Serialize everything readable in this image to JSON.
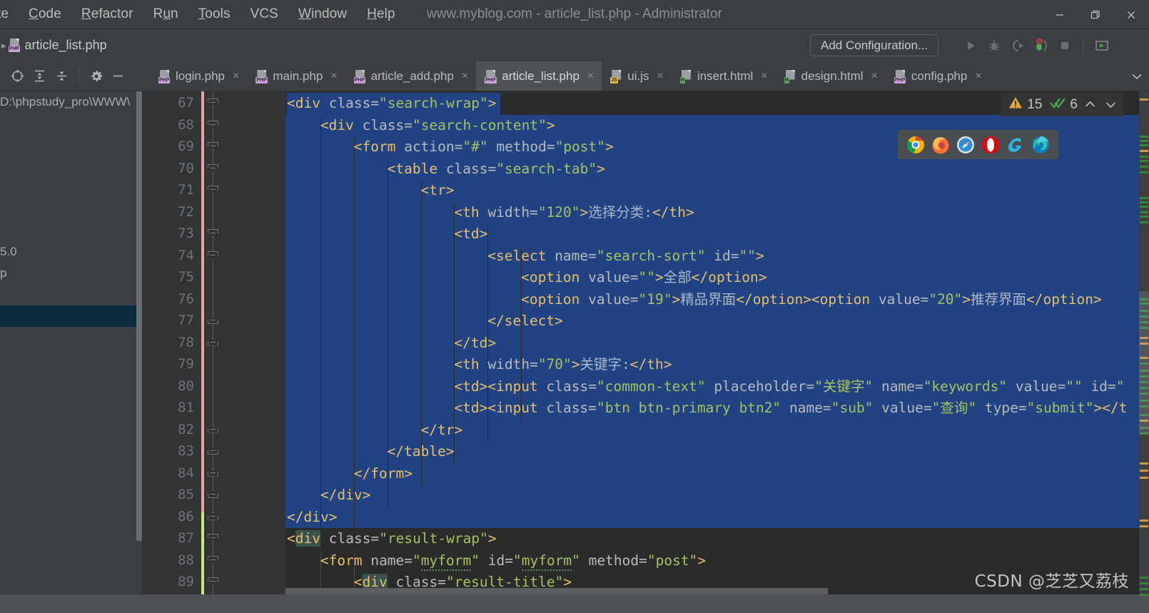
{
  "window": {
    "title": "www.myblog.com - article_list.php - Administrator",
    "controls": {
      "minimize": "minimize-icon",
      "restore": "restore-icon",
      "close": "close-icon"
    }
  },
  "menubar": {
    "items": [
      {
        "label": "te",
        "mnemonic": ""
      },
      {
        "label": "Code",
        "mnemonic": "C"
      },
      {
        "label": "Refactor",
        "mnemonic": "R"
      },
      {
        "label": "Run",
        "mnemonic": "u"
      },
      {
        "label": "Tools",
        "mnemonic": "T"
      },
      {
        "label": "VCS",
        "mnemonic": ""
      },
      {
        "label": "Window",
        "mnemonic": "W"
      },
      {
        "label": "Help",
        "mnemonic": "H"
      }
    ]
  },
  "navbar": {
    "breadcrumb": "article_list.php",
    "add_configuration": "Add Configuration...",
    "run_icons": [
      "run-icon",
      "debug-icon",
      "run-with-coverage-icon",
      "profile-icon",
      "stop-icon",
      "run-tool-icon"
    ]
  },
  "left_toolbar": {
    "buttons": [
      "locate-icon",
      "expand-all-icon",
      "collapse-all-icon",
      "settings-gear-icon",
      "hide-icon"
    ]
  },
  "tabs": {
    "items": [
      {
        "label": "login.php",
        "type": "PHP",
        "active": false
      },
      {
        "label": "main.php",
        "type": "PHP",
        "active": false
      },
      {
        "label": "article_add.php",
        "type": "PHP",
        "active": false
      },
      {
        "label": "article_list.php",
        "type": "PHP",
        "active": true
      },
      {
        "label": "ui.js",
        "type": "JS",
        "active": false
      },
      {
        "label": "insert.html",
        "type": "H",
        "active": false
      },
      {
        "label": "design.html",
        "type": "H",
        "active": false
      },
      {
        "label": "config.php",
        "type": "PHP",
        "active": false
      }
    ],
    "close_glyph": "×",
    "overflow_glyph": "⌄"
  },
  "project_panel": {
    "rows": [
      {
        "text": "D:\\phpstudy_pro\\WWW\\",
        "selected": false,
        "color": "#aaadaf"
      },
      {
        "text": "",
        "selected": false,
        "color": "#aaadaf"
      },
      {
        "text": "",
        "selected": false,
        "color": "#aaadaf"
      },
      {
        "text": "",
        "selected": false,
        "color": "#aaadaf"
      },
      {
        "text": "",
        "selected": false,
        "color": "#aaadaf"
      },
      {
        "text": "",
        "selected": false,
        "color": "#aaadaf"
      },
      {
        "text": "",
        "selected": false,
        "color": "#aaadaf"
      },
      {
        "text": "5.0",
        "selected": false,
        "color": "#aaadaf"
      },
      {
        "text": "p",
        "selected": false,
        "color": "#aaadaf"
      },
      {
        "text": "",
        "selected": false,
        "color": "#cc8242"
      },
      {
        "text": "",
        "selected": true,
        "color": "#aaadaf"
      }
    ]
  },
  "inspections": {
    "warning_icon": "warning-triangle-icon",
    "warning_count": "15",
    "check_icon": "inspection-check-icon",
    "check_count": "6",
    "prev_glyph": "⌃",
    "next_glyph": "⌄"
  },
  "browser_popup": {
    "browsers": [
      "chrome-icon",
      "firefox-icon",
      "safari-icon",
      "opera-icon",
      "internet-explorer-icon",
      "edge-icon"
    ]
  },
  "watermark": "CSDN @芝芝又荔枝",
  "editor": {
    "first_line": 67,
    "line_count": 23,
    "lines": [
      {
        "n": 67,
        "indent": 0,
        "selected": true,
        "sel_full": false,
        "tokens": [
          {
            "t": "punct",
            "s": "<div "
          },
          {
            "t": "attr",
            "s": "class="
          },
          {
            "t": "val",
            "s": "\"search-wrap\""
          },
          {
            "t": "punct",
            "s": ">"
          }
        ]
      },
      {
        "n": 68,
        "indent": 4,
        "selected": true,
        "sel_full": true,
        "tokens": [
          {
            "t": "punct",
            "s": "<div "
          },
          {
            "t": "attr",
            "s": "class="
          },
          {
            "t": "val",
            "s": "\"search-content\""
          },
          {
            "t": "punct",
            "s": ">"
          }
        ]
      },
      {
        "n": 69,
        "indent": 8,
        "selected": true,
        "sel_full": true,
        "tokens": [
          {
            "t": "punct",
            "s": "<form "
          },
          {
            "t": "attr",
            "s": "action="
          },
          {
            "t": "val",
            "s": "\"#\""
          },
          {
            "t": "text",
            "s": " "
          },
          {
            "t": "attr",
            "s": "method="
          },
          {
            "t": "val",
            "s": "\"post\""
          },
          {
            "t": "punct",
            "s": ">"
          }
        ]
      },
      {
        "n": 70,
        "indent": 12,
        "selected": true,
        "sel_full": true,
        "tokens": [
          {
            "t": "punct",
            "s": "<table "
          },
          {
            "t": "attr",
            "s": "class="
          },
          {
            "t": "val",
            "s": "\"search-tab\""
          },
          {
            "t": "punct",
            "s": ">"
          }
        ]
      },
      {
        "n": 71,
        "indent": 16,
        "selected": true,
        "sel_full": true,
        "tokens": [
          {
            "t": "punct",
            "s": "<tr>"
          }
        ]
      },
      {
        "n": 72,
        "indent": 20,
        "selected": true,
        "sel_full": true,
        "tokens": [
          {
            "t": "punct",
            "s": "<th "
          },
          {
            "t": "attr",
            "s": "width="
          },
          {
            "t": "val",
            "s": "\"120\""
          },
          {
            "t": "punct",
            "s": ">"
          },
          {
            "t": "text",
            "s": "选择分类:"
          },
          {
            "t": "punct",
            "s": "</th>"
          }
        ]
      },
      {
        "n": 73,
        "indent": 20,
        "selected": true,
        "sel_full": true,
        "tokens": [
          {
            "t": "punct",
            "s": "<td>"
          }
        ]
      },
      {
        "n": 74,
        "indent": 24,
        "selected": true,
        "sel_full": true,
        "tokens": [
          {
            "t": "punct",
            "s": "<select "
          },
          {
            "t": "attr",
            "s": "name="
          },
          {
            "t": "val",
            "s": "\"search-sort\""
          },
          {
            "t": "text",
            "s": " "
          },
          {
            "t": "attr",
            "s": "id="
          },
          {
            "t": "val",
            "s": "\"\""
          },
          {
            "t": "punct",
            "s": ">"
          }
        ]
      },
      {
        "n": 75,
        "indent": 28,
        "selected": true,
        "sel_full": true,
        "tokens": [
          {
            "t": "punct",
            "s": "<option "
          },
          {
            "t": "attr",
            "s": "value="
          },
          {
            "t": "val",
            "s": "\"\""
          },
          {
            "t": "punct",
            "s": ">"
          },
          {
            "t": "text",
            "s": "全部"
          },
          {
            "t": "punct",
            "s": "</option>"
          }
        ]
      },
      {
        "n": 76,
        "indent": 28,
        "selected": true,
        "sel_full": true,
        "tokens": [
          {
            "t": "punct",
            "s": "<option "
          },
          {
            "t": "attr",
            "s": "value="
          },
          {
            "t": "val",
            "s": "\"19\""
          },
          {
            "t": "punct",
            "s": ">"
          },
          {
            "t": "text",
            "s": "精品界面"
          },
          {
            "t": "punct",
            "s": "</option><option "
          },
          {
            "t": "attr",
            "s": "value="
          },
          {
            "t": "val",
            "s": "\"20\""
          },
          {
            "t": "punct",
            "s": ">"
          },
          {
            "t": "text",
            "s": "推荐界面"
          },
          {
            "t": "punct",
            "s": "</option>"
          }
        ]
      },
      {
        "n": 77,
        "indent": 24,
        "selected": true,
        "sel_full": true,
        "tokens": [
          {
            "t": "punct",
            "s": "</select>"
          }
        ]
      },
      {
        "n": 78,
        "indent": 20,
        "selected": true,
        "sel_full": true,
        "tokens": [
          {
            "t": "punct",
            "s": "</td>"
          }
        ]
      },
      {
        "n": 79,
        "indent": 20,
        "selected": true,
        "sel_full": true,
        "tokens": [
          {
            "t": "punct",
            "s": "<th "
          },
          {
            "t": "attr",
            "s": "width="
          },
          {
            "t": "val",
            "s": "\"70\""
          },
          {
            "t": "punct",
            "s": ">"
          },
          {
            "t": "text",
            "s": "关键字:"
          },
          {
            "t": "punct",
            "s": "</th>"
          }
        ]
      },
      {
        "n": 80,
        "indent": 20,
        "selected": true,
        "sel_full": true,
        "tokens": [
          {
            "t": "punct",
            "s": "<td><input "
          },
          {
            "t": "attr",
            "s": "class="
          },
          {
            "t": "val",
            "s": "\"common-text\""
          },
          {
            "t": "text",
            "s": " "
          },
          {
            "t": "attr",
            "s": "placeholder="
          },
          {
            "t": "val",
            "s": "\"关键字\""
          },
          {
            "t": "text",
            "s": " "
          },
          {
            "t": "attr",
            "s": "name="
          },
          {
            "t": "val",
            "s": "\"keywords\""
          },
          {
            "t": "text",
            "s": " "
          },
          {
            "t": "attr",
            "s": "value="
          },
          {
            "t": "val",
            "s": "\"\""
          },
          {
            "t": "text",
            "s": " "
          },
          {
            "t": "attr",
            "s": "id="
          },
          {
            "t": "val",
            "s": "\""
          }
        ]
      },
      {
        "n": 81,
        "indent": 20,
        "selected": true,
        "sel_full": true,
        "tokens": [
          {
            "t": "punct",
            "s": "<td><input "
          },
          {
            "t": "attr",
            "s": "class="
          },
          {
            "t": "val",
            "s": "\"btn btn-primary btn2\""
          },
          {
            "t": "text",
            "s": " "
          },
          {
            "t": "attr",
            "s": "name="
          },
          {
            "t": "val",
            "s": "\"sub\""
          },
          {
            "t": "text",
            "s": " "
          },
          {
            "t": "attr",
            "s": "value="
          },
          {
            "t": "val",
            "s": "\"查询\""
          },
          {
            "t": "text",
            "s": " "
          },
          {
            "t": "attr",
            "s": "type="
          },
          {
            "t": "val",
            "s": "\"submit\""
          },
          {
            "t": "punct",
            "s": "></t"
          }
        ]
      },
      {
        "n": 82,
        "indent": 16,
        "selected": true,
        "sel_full": true,
        "tokens": [
          {
            "t": "punct",
            "s": "</tr>"
          }
        ]
      },
      {
        "n": 83,
        "indent": 12,
        "selected": true,
        "sel_full": true,
        "tokens": [
          {
            "t": "punct",
            "s": "</table>"
          }
        ]
      },
      {
        "n": 84,
        "indent": 8,
        "selected": true,
        "sel_full": true,
        "tokens": [
          {
            "t": "punct",
            "s": "</form>"
          }
        ]
      },
      {
        "n": 85,
        "indent": 4,
        "selected": true,
        "sel_full": true,
        "tokens": [
          {
            "t": "punct",
            "s": "</div>"
          }
        ]
      },
      {
        "n": 86,
        "indent": 0,
        "selected": true,
        "sel_full": false,
        "tokens": [
          {
            "t": "punct",
            "s": "</div>"
          }
        ]
      },
      {
        "n": 87,
        "indent": 0,
        "selected": false,
        "sel_full": false,
        "tokens": [
          {
            "t": "punct",
            "s": "<"
          },
          {
            "t": "brace",
            "s": "div"
          },
          {
            "t": "text",
            "s": " "
          },
          {
            "t": "attr",
            "s": "class="
          },
          {
            "t": "val",
            "s": "\"result-wrap\""
          },
          {
            "t": "punct",
            "s": ">"
          }
        ]
      },
      {
        "n": 88,
        "indent": 4,
        "selected": false,
        "sel_full": false,
        "tokens": [
          {
            "t": "punct",
            "s": "<form "
          },
          {
            "t": "attr",
            "s": "name="
          },
          {
            "t": "val",
            "s": "\""
          },
          {
            "t": "squig",
            "s": "myform"
          },
          {
            "t": "val",
            "s": "\""
          },
          {
            "t": "text",
            "s": " "
          },
          {
            "t": "attr",
            "s": "id="
          },
          {
            "t": "val",
            "s": "\""
          },
          {
            "t": "squig",
            "s": "myform"
          },
          {
            "t": "val",
            "s": "\""
          },
          {
            "t": "text",
            "s": " "
          },
          {
            "t": "attr",
            "s": "method="
          },
          {
            "t": "val",
            "s": "\"post\""
          },
          {
            "t": "punct",
            "s": ">"
          }
        ]
      },
      {
        "n": 89,
        "indent": 8,
        "selected": false,
        "sel_full": false,
        "tokens": [
          {
            "t": "punct",
            "s": "<"
          },
          {
            "t": "brace",
            "s": "div"
          },
          {
            "t": "text",
            "s": " "
          },
          {
            "t": "attr",
            "s": "class="
          },
          {
            "t": "val",
            "s": "\"result-title\""
          },
          {
            "t": "punct",
            "s": ">"
          }
        ]
      }
    ]
  },
  "colors": {
    "editor_bg": "#2b2b2b",
    "gutter_bg": "#313335",
    "chrome_bg": "#3c3f41",
    "selection": "#214283",
    "tag": "#e8bf6a",
    "attr_value": "#a5c261",
    "text": "#a9b7c6",
    "accent_green": "#2e8b3d",
    "accent_orange": "#cc9c3b",
    "change_modified": "#e8a0a0",
    "change_added": "#c9e87e"
  }
}
